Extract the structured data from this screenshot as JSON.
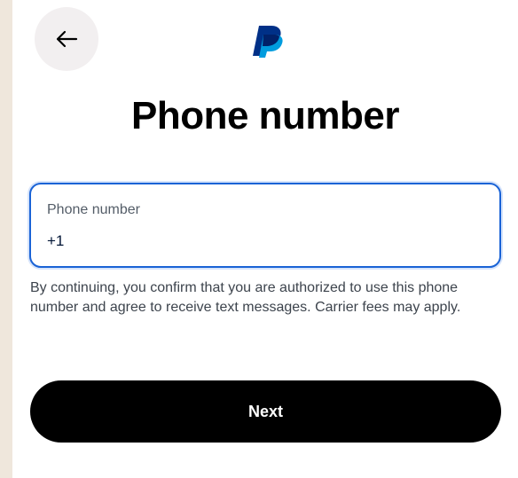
{
  "colors": {
    "accent_border": "#1a63d6",
    "button_bg": "#000000",
    "button_text": "#ffffff",
    "back_button_bg": "#f2eff0",
    "logo_dark": "#003087",
    "logo_light": "#009cde"
  },
  "header": {
    "back_icon": "arrow-left-icon",
    "logo_icon": "paypal-logo"
  },
  "page": {
    "title": "Phone number"
  },
  "form": {
    "phone_label": "Phone number",
    "phone_value": "+1"
  },
  "disclaimer": "By continuing, you confirm that you are authorized to use this phone number and agree to receive text messages. Carrier fees may apply.",
  "actions": {
    "next_label": "Next"
  }
}
